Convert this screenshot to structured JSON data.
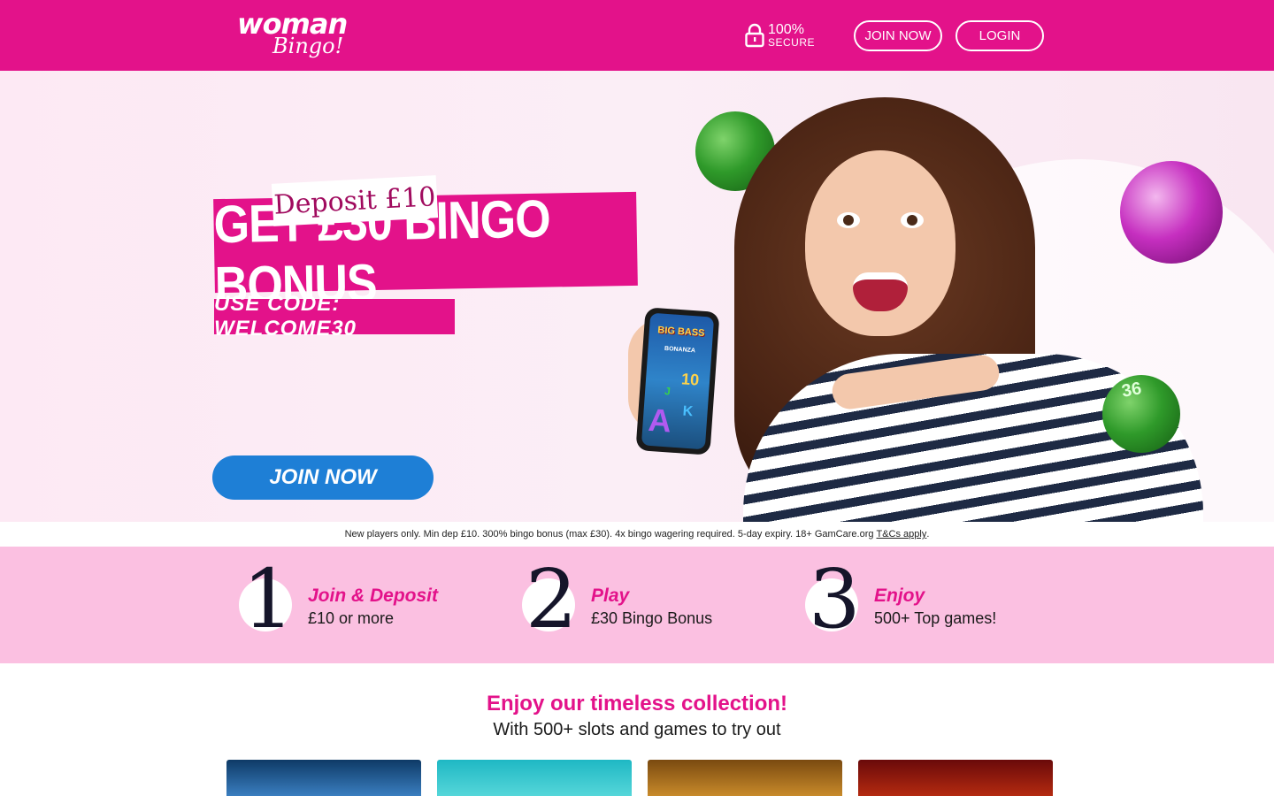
{
  "header": {
    "logo_word": "woman",
    "logo_script": "Bingo!",
    "secure_pct": "100%",
    "secure_label": "SECURE",
    "join_label": "JOIN NOW",
    "login_label": "LOGIN"
  },
  "hero": {
    "deposit": "Deposit £10",
    "bonus": "GET £30 BINGO BONUS",
    "code": "USE CODE: WELCOME30",
    "join_label": "JOIN NOW",
    "ball_number": "36",
    "phone_title": "BIG BASS",
    "phone_subtitle": "BONANZA",
    "phone_symbols": [
      "10",
      "J",
      "A",
      "K"
    ]
  },
  "disclaimer": {
    "text": "New players only. Min dep £10. 300% bingo bonus (max £30). 4x bingo wagering required. 5-day expiry. 18+ GamCare.org",
    "link": "T&Cs apply",
    "end": "."
  },
  "steps": [
    {
      "number": "1",
      "title": "Join & Deposit",
      "desc": "£10 or more"
    },
    {
      "number": "2",
      "title": "Play",
      "desc": "£30 Bingo Bonus"
    },
    {
      "number": "3",
      "title": "Enjoy",
      "desc": "500+ Top games!"
    }
  ],
  "collection": {
    "title": "Enjoy our timeless collection!",
    "subtitle": "With 500+ slots and games to try out"
  },
  "colors": {
    "brand_pink": "#e3128a",
    "steps_bg": "#fbc0e1",
    "join_blue": "#1e7fd6"
  }
}
